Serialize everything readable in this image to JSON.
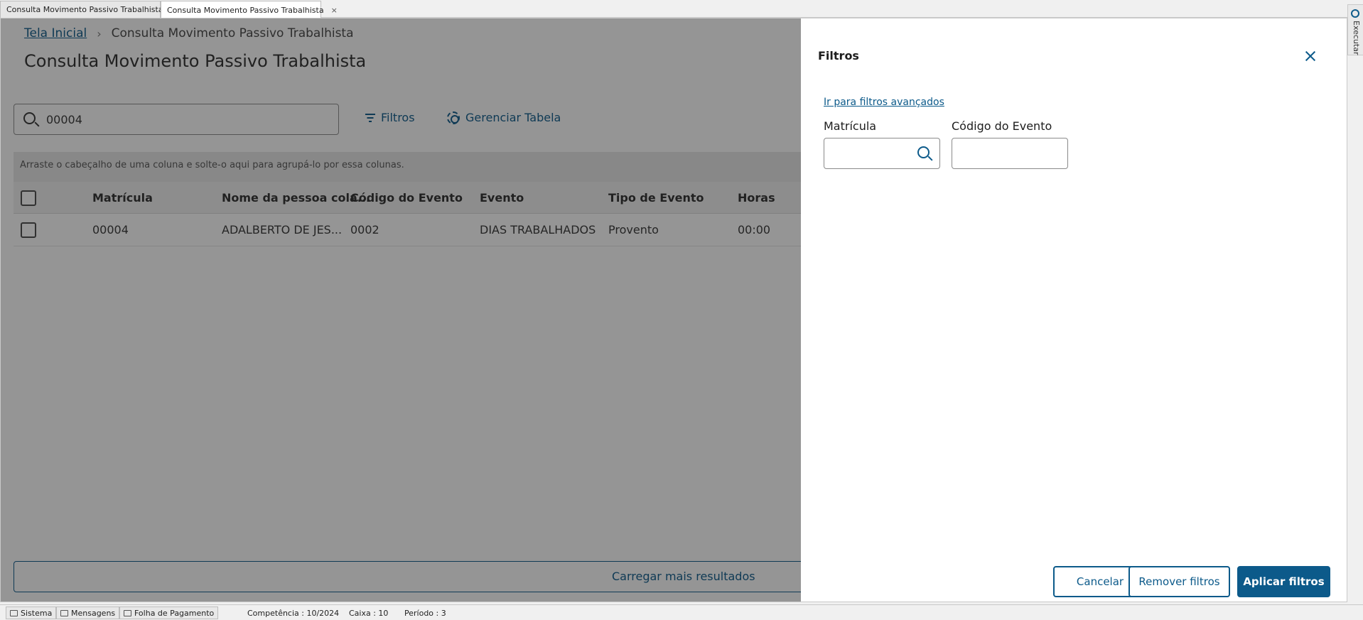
{
  "window_tabs": [
    {
      "label": "Consulta Movimento Passivo Trabalhista",
      "close": "×",
      "active": false
    },
    {
      "label": "Consulta Movimento Passivo Trabalhista",
      "close": "×",
      "active": true
    }
  ],
  "side_panel": {
    "label": "Executar"
  },
  "breadcrumb": {
    "home": "Tela Inicial",
    "separator": "›",
    "current": "Consulta Movimento Passivo Trabalhista"
  },
  "page": {
    "title": "Consulta Movimento Passivo Trabalhista"
  },
  "search": {
    "value": "00004"
  },
  "toolbar": {
    "filters_label": "Filtros",
    "manage_table_label": "Gerenciar Tabela"
  },
  "grid": {
    "group_hint": "Arraste o cabeçalho de uma coluna e solte-o aqui para agrupá-lo por essa colunas.",
    "columns": [
      "Matrícula",
      "Nome da pessoa cola...",
      "Código do Evento",
      "Evento",
      "Tipo de Evento",
      "Horas"
    ],
    "rows": [
      [
        "00004",
        "ADALBERTO DE JES...",
        "0002",
        "DIAS TRABALHADOS",
        "Provento",
        "00:00"
      ]
    ],
    "load_more": "Carregar mais resultados"
  },
  "drawer": {
    "title": "Filtros",
    "advanced_link": "Ir para filtros avançados",
    "fields": [
      {
        "label": "Matrícula",
        "value": ""
      },
      {
        "label": "Código do Evento",
        "value": ""
      }
    ],
    "buttons": {
      "cancel": "Cancelar",
      "remove": "Remover filtros",
      "apply": "Aplicar filtros"
    }
  },
  "statusbar": {
    "sistema": "Sistema",
    "mensagens": "Mensagens",
    "modulo": "Folha de Pagamento",
    "competencia": "Competência : 10/2024",
    "caixa": "Caixa : 10",
    "periodo": "Período : 3"
  },
  "colors": {
    "accent": "#0c5a8a",
    "overlay": "rgba(20,20,20,0.45)"
  }
}
